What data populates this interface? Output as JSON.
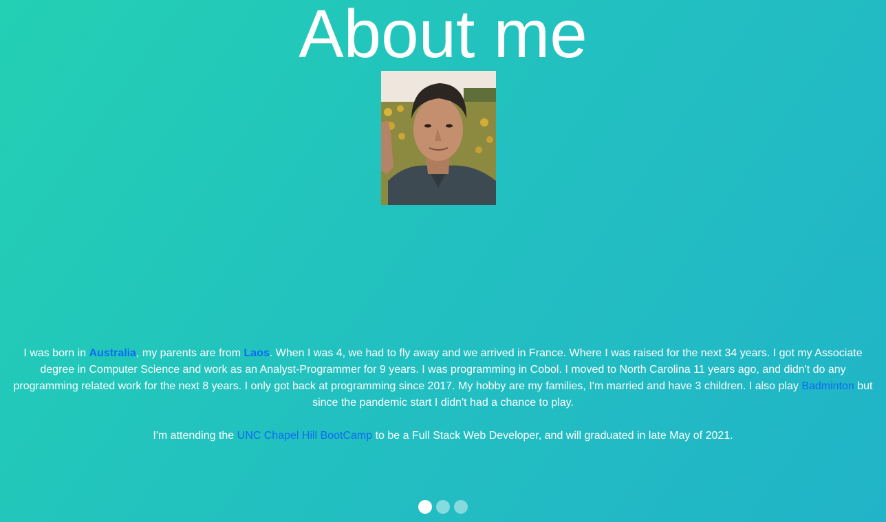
{
  "page": {
    "title": "About me"
  },
  "bio": {
    "p1": {
      "t1": "I was born in ",
      "link_australia": "Australia",
      "t2": ", my parents are from ",
      "link_laos": "Laos",
      "t3": ". When I was 4, we had to fly away and we arrived in France. Where I was raised for the next 34 years. I got my Associate degree in Computer Science and work as an Analyst-Programmer for 9 years. I was programming in Cobol. I moved to North Carolina 11 years ago, and didn't do any programming related work for the next 8 years. I only got back at programming since 2017. My hobby are my families, I'm married and have 3 children. I also play ",
      "link_badminton": "Badminton",
      "t4": " but since the pandemic start I didn't had a chance to play."
    },
    "p2": {
      "t1": "I'm attending the ",
      "link_bootcamp": "UNC Chapel Hill BootCamp",
      "t2": " to be a Full Stack Web Developer, and will graduated in late May of 2021."
    }
  },
  "carousel": {
    "active_index": 0,
    "count": 3
  },
  "colors": {
    "link": "#0a6cf2",
    "text": "#ffffff",
    "bg_start": "#23d0b3",
    "bg_end": "#21b4c8"
  }
}
